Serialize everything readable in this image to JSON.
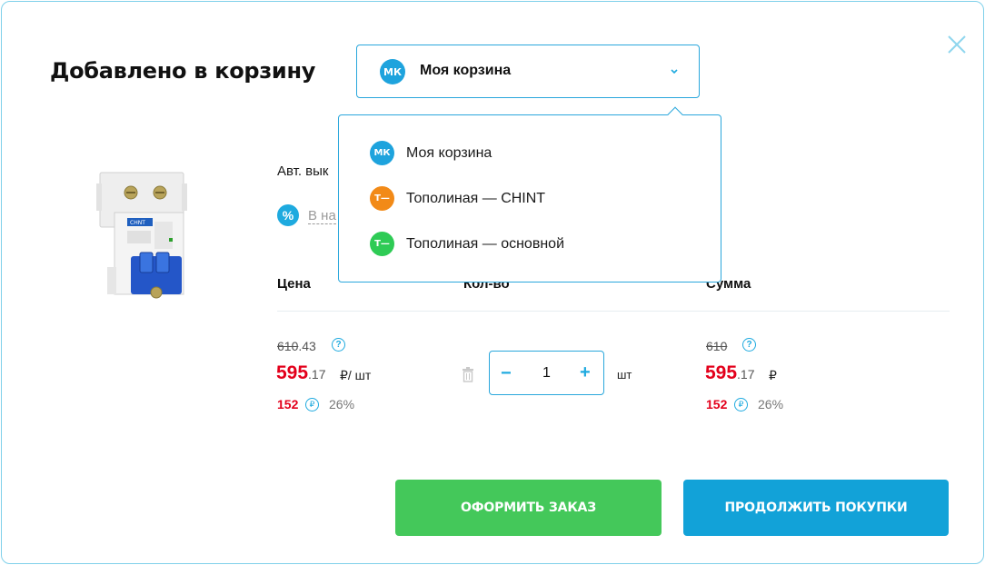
{
  "modal": {
    "title": "Добавлено в корзину"
  },
  "cart_selector": {
    "avatar": "МК",
    "selected": "Моя корзина",
    "icon": "chevron-down-icon"
  },
  "dropdown": {
    "items": [
      {
        "avatar": "МК",
        "label": "Моя корзина",
        "color": "#1ea3dd"
      },
      {
        "avatar": "Т—",
        "label": "Тополиная — CHINT",
        "color": "#f28a17"
      },
      {
        "avatar": "Т—",
        "label": "Тополиная — основной",
        "color": "#2ecb55"
      }
    ]
  },
  "product": {
    "name": "Авт. вык",
    "promo_link": "В на",
    "image_alt": "CHINT circuit breaker",
    "image_brand": "CHNT"
  },
  "columns": {
    "price": "Цена",
    "qty": "Кол-во",
    "sum": "Сумма"
  },
  "price": {
    "old_int": "610",
    "old_kop": ".43",
    "new_int": "595",
    "new_kop": ".17",
    "unit": "₽/ шт",
    "bonus": "152",
    "bonus_icon": "₽",
    "bonus_pct": "26%"
  },
  "quantity": {
    "minus": "−",
    "value": "1",
    "plus": "+",
    "unit": "шт"
  },
  "sum": {
    "old_int": "610",
    "new_int": "595",
    "new_kop": ".17",
    "currency": "₽",
    "bonus": "152",
    "bonus_icon": "₽",
    "bonus_pct": "26%"
  },
  "buttons": {
    "order": "ОФОРМИТЬ ЗАКАЗ",
    "continue": "ПРОДОЛЖИТЬ ПОКУПКИ"
  },
  "colors": {
    "accent": "#1eaadf",
    "price_red": "#e3001b",
    "order_green": "#44c85a",
    "continue_blue": "#12a2d8"
  }
}
